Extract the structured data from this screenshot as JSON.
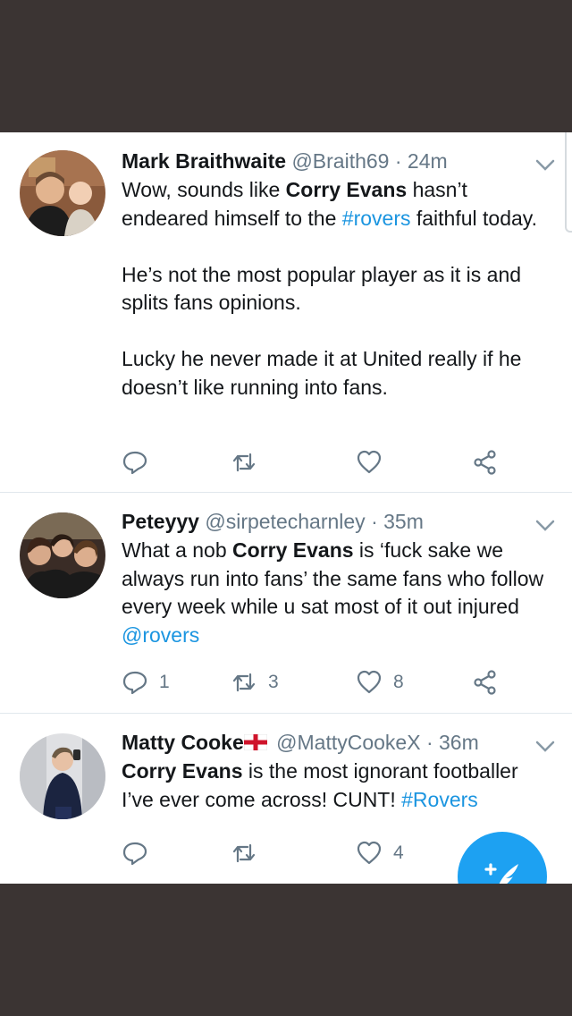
{
  "tweets": [
    {
      "name": "Mark Braithwaite",
      "handle": "@Braith69",
      "dot": "·",
      "time": "24m",
      "lines": {
        "p1_a": "Wow, sounds like ",
        "p1_b": "Corry Evans",
        "p1_c": " hasn’t endeared himself to the ",
        "p1_d": "#rovers",
        "p1_e": " faithful today.",
        "p2": "He’s not the most popular player as it is and splits fans opinions.",
        "p3": "Lucky he never made it at United really if he doesn’t like running into fans."
      },
      "counts": {
        "reply": "",
        "retweet": "",
        "like": ""
      }
    },
    {
      "name": "Peteyyy",
      "handle": "@sirpetecharnley",
      "dot": "·",
      "time": "35m",
      "lines": {
        "a": "What a nob ",
        "b": "Corry Evans",
        "c": " is ‘fuck sake we always run into fans’ the same fans who follow every week while u sat most of it out injured ",
        "d": "@rovers"
      },
      "counts": {
        "reply": "1",
        "retweet": "3",
        "like": "8"
      }
    },
    {
      "name": "Matty Cooke",
      "handle": "@MattyCookeX",
      "dot": "·",
      "time": "36m",
      "lines": {
        "a": "Corry Evans",
        "b": " is the most ignorant footballer I’ve ever come across! CUNT! ",
        "c": "#Rovers"
      },
      "counts": {
        "reply": "",
        "retweet": "",
        "like": "4"
      }
    }
  ],
  "icons": {
    "reply": "reply-icon",
    "retweet": "retweet-icon",
    "like": "heart-icon",
    "share": "share-icon",
    "menu": "chevron-down-icon",
    "compose": "compose-tweet-icon",
    "flag": "england-flag-icon"
  },
  "colors": {
    "text": "#14171a",
    "secondary": "#657786",
    "link": "#1b95e0",
    "accent": "#1da1f2",
    "frame": "#3b3433"
  }
}
